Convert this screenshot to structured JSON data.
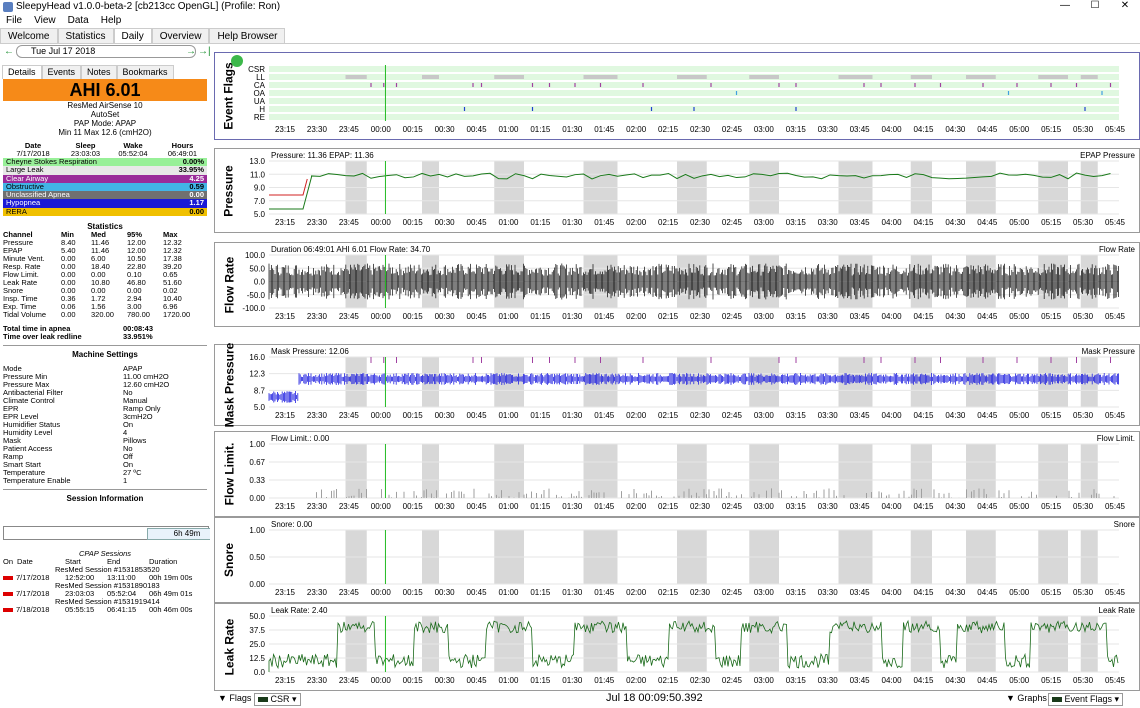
{
  "window": {
    "title": "SleepyHead v1.0.0-beta-2 [cb213cc OpenGL] (Profile: Ron)",
    "min": "—",
    "max": "☐",
    "close": "✕"
  },
  "menu": [
    "File",
    "View",
    "Data",
    "Help"
  ],
  "tabs": [
    "Welcome",
    "Statistics",
    "Daily",
    "Overview",
    "Help Browser"
  ],
  "active_tab": "Daily",
  "date": {
    "value": "Tue Jul 17 2018",
    "prev": "←",
    "next": "→",
    "last": "→|"
  },
  "subtabs": [
    "Details",
    "Events",
    "Notes",
    "Bookmarks"
  ],
  "ahi": "AHI 6.01",
  "machine": {
    "name": "ResMed AirSense 10",
    "mode": "AutoSet",
    "pap_mode": "PAP Mode: APAP",
    "range": "Min 11 Max 12.6 (cmH2O)"
  },
  "summary": {
    "headers": [
      "Date",
      "Sleep",
      "Wake",
      "Hours"
    ],
    "values": [
      "7/17/2018",
      "23:03:03",
      "05:52:04",
      "06:49:01"
    ]
  },
  "events": [
    {
      "name": "Cheyne Stokes Respiration",
      "value": "0.00%",
      "color": "#98f098",
      "text": "#000"
    },
    {
      "name": "Large Leak",
      "value": "33.95%",
      "color": "#e8e8e8",
      "text": "#000"
    },
    {
      "name": "Clear Airway",
      "value": "4.25",
      "color": "#9a2c9a",
      "text": "#fff"
    },
    {
      "name": "Obstructive",
      "value": "0.59",
      "color": "#42b4e6",
      "text": "#000"
    },
    {
      "name": "Unclassified Apnea",
      "value": "0.00",
      "color": "#707070",
      "text": "#fff"
    },
    {
      "name": "Hypopnea",
      "value": "1.17",
      "color": "#1a1ad6",
      "text": "#fff"
    },
    {
      "name": "RERA",
      "value": "0.00",
      "color": "#f0c000",
      "text": "#000"
    }
  ],
  "statistics": {
    "title": "Statistics",
    "headers": [
      "Channel",
      "Min",
      "Med",
      "95%",
      "Max"
    ],
    "rows": [
      [
        "Pressure",
        "8.40",
        "11.46",
        "12.00",
        "12.32"
      ],
      [
        "EPAP",
        "5.40",
        "11.46",
        "12.00",
        "12.32"
      ],
      [
        "Minute Vent.",
        "0.00",
        "6.00",
        "10.50",
        "17.38"
      ],
      [
        "Resp. Rate",
        "0.00",
        "18.40",
        "22.80",
        "39.20"
      ],
      [
        "Flow Limit.",
        "0.00",
        "0.00",
        "0.10",
        "0.65"
      ],
      [
        "Leak Rate",
        "0.00",
        "10.80",
        "46.80",
        "51.60"
      ],
      [
        "Snore",
        "0.00",
        "0.00",
        "0.00",
        "0.02"
      ],
      [
        "Insp. Time",
        "0.36",
        "1.72",
        "2.94",
        "10.40"
      ],
      [
        "Exp. Time",
        "0.06",
        "1.56",
        "3.00",
        "6.96"
      ],
      [
        "Tidal Volume",
        "0.00",
        "320.00",
        "780.00",
        "1720.00"
      ]
    ]
  },
  "apnea": [
    {
      "label": "Total time in apnea",
      "value": "00:08:43"
    },
    {
      "label": "Time over leak redline",
      "value": "33.951%"
    }
  ],
  "settings": {
    "title": "Machine Settings",
    "rows": [
      [
        "Mode",
        "APAP"
      ],
      [
        "Pressure Min",
        "11.00 cmH2O"
      ],
      [
        "Pressure Max",
        "12.60 cmH2O"
      ],
      [
        "Antibacterial Filter",
        "No"
      ],
      [
        "Climate Control",
        "Manual"
      ],
      [
        "EPR",
        "Ramp Only"
      ],
      [
        "EPR Level",
        "3cmH2O"
      ],
      [
        "Humidifier Status",
        "On"
      ],
      [
        "Humidity Level",
        "4"
      ],
      [
        "Mask",
        "Pillows"
      ],
      [
        "Patient Access",
        "No"
      ],
      [
        "Ramp",
        "Off"
      ],
      [
        "Smart Start",
        "On"
      ],
      [
        "Temperature",
        "27 ºC"
      ],
      [
        "Temperature Enable",
        "1"
      ]
    ]
  },
  "session_info": {
    "title": "Session Information",
    "duration": "6h 49m"
  },
  "cpap": {
    "title": "CPAP Sessions",
    "headers": [
      "On",
      "Date",
      "Start",
      "End",
      "Duration"
    ],
    "sessions": [
      {
        "name": "ResMed Session #1531853520",
        "date": "7/17/2018",
        "start": "12:52:00",
        "end": "13:11:00",
        "duration": "00h 19m 00s"
      },
      {
        "name": "ResMed Session #1531890183",
        "date": "7/17/2018",
        "start": "23:03:03",
        "end": "05:52:04",
        "duration": "06h 49m 01s"
      },
      {
        "name": "ResMed Session #1531919414",
        "date": "7/18/2018",
        "start": "05:55:15",
        "end": "06:41:15",
        "duration": "00h 46m 00s"
      }
    ]
  },
  "x_ticks": [
    "23:15",
    "23:30",
    "23:45",
    "00:00",
    "00:15",
    "00:30",
    "00:45",
    "01:00",
    "01:15",
    "01:30",
    "01:45",
    "02:00",
    "02:15",
    "02:30",
    "02:45",
    "03:00",
    "03:15",
    "03:30",
    "03:45",
    "04:00",
    "04:15",
    "04:30",
    "04:45",
    "05:00",
    "05:15",
    "05:30",
    "05:45"
  ],
  "graphs": [
    {
      "id": "flags",
      "label": "Event Flags",
      "rows": [
        "CSR",
        "LL",
        "CA",
        "OA",
        "UA",
        "H",
        "RE"
      ]
    },
    {
      "id": "pressure",
      "label": "Pressure",
      "info": "Pressure: 11.36 EPAP: 11.36",
      "legend": "EPAP Pressure",
      "yticks": [
        "13.0",
        "11.0",
        "9.0",
        "7.0",
        "5.0"
      ]
    },
    {
      "id": "flow",
      "label": "Flow Rate",
      "info": "Duration 06:49:01 AHI 6.01 Flow Rate: 34.70",
      "legend": "Flow Rate",
      "yticks": [
        "100.0",
        "50.0",
        "0.0",
        "-50.0",
        "-100.0"
      ]
    },
    {
      "id": "mask",
      "label": "Mask Pressure",
      "info": "Mask Pressure: 12.06",
      "legend": "Mask Pressure",
      "yticks": [
        "16.0",
        "12.3",
        "8.7",
        "5.0"
      ]
    },
    {
      "id": "flowlim",
      "label": "Flow Limit.",
      "info": "Flow Limit.: 0.00",
      "legend": "Flow Limit.",
      "yticks": [
        "1.00",
        "0.67",
        "0.33",
        "0.00"
      ]
    },
    {
      "id": "snore",
      "label": "Snore",
      "info": "Snore: 0.00",
      "legend": "Snore",
      "yticks": [
        "1.00",
        "0.50",
        "0.00"
      ]
    },
    {
      "id": "leak",
      "label": "Leak Rate",
      "info": "Leak Rate: 2.40",
      "legend": "Leak Rate",
      "yticks": [
        "50.0",
        "37.5",
        "25.0",
        "12.5",
        "0.0"
      ]
    }
  ],
  "bottom": {
    "flags": "Flags",
    "csr": "CSR",
    "datetime": "Jul 18 00:09:50.392",
    "graphs": "Graphs",
    "event_flags": "Event Flags"
  },
  "colors": {
    "ahi": "#f68a18",
    "pressure_line": "#1a7a1a",
    "epap_line": "#d02020",
    "flow": "#000000",
    "mask": "#2020e0",
    "flowlim": "#a0a0a0",
    "leak": "#1a6a1a",
    "cursor": "#22bb22",
    "leak_shade": "#d8d8d8",
    "flags_bg": "#e0f8e0",
    "panel_border": "#6a6ab0",
    "ca_marker": "#a040a0",
    "oa_marker": "#40a0e0",
    "h_marker": "#2040d0"
  }
}
